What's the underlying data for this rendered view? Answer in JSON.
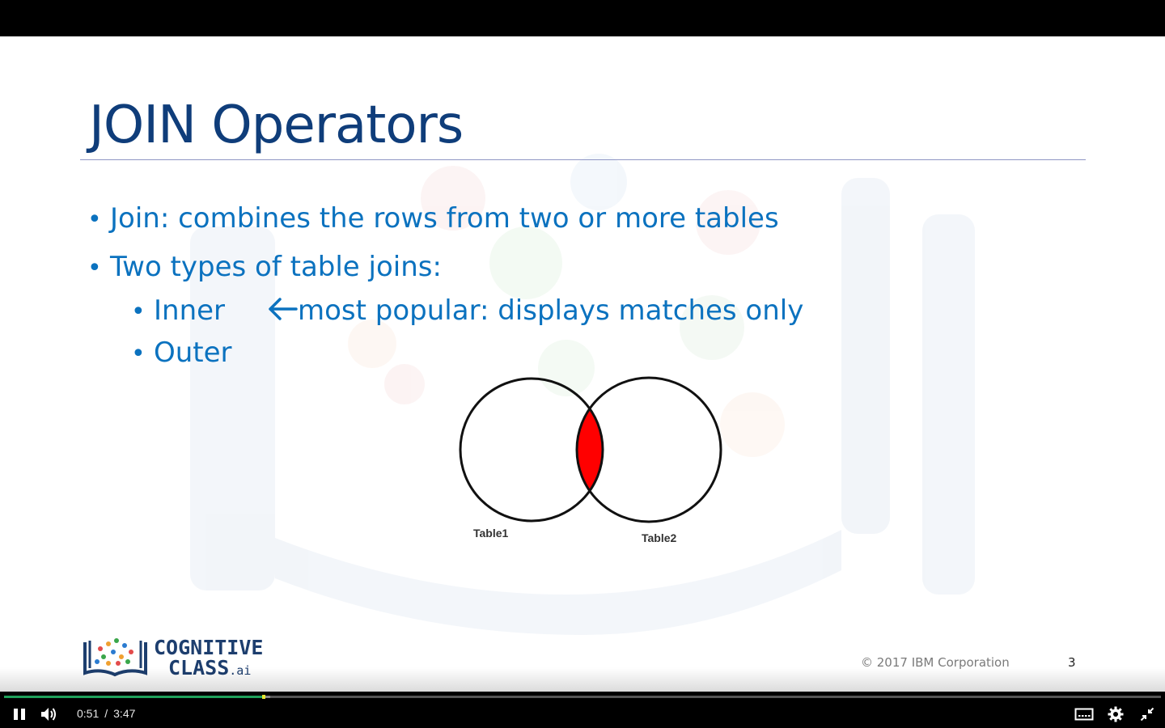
{
  "slide": {
    "title": "JOIN Operators",
    "bullets": [
      "Join: combines the rows from two or more tables",
      "Two types of table joins:"
    ],
    "sub_bullets": [
      "Inner",
      "Outer"
    ],
    "inner_note": "most popular: displays matches only",
    "bullet_glyph": "•",
    "arrow_glyph": "🡐",
    "venn": {
      "left_label": "Table1",
      "right_label": "Table2",
      "intersection_color": "#ff0000"
    },
    "logo": {
      "line1": "COGNITIVE",
      "line2": "CLASS",
      "suffix": ".ai"
    },
    "copyright": "© 2017 IBM Corporation",
    "page_number": "3"
  },
  "player": {
    "current_time": "0:51",
    "separator": "/",
    "duration": "3:47",
    "progress_fraction": 0.2247,
    "buffered_fraction": 0.23,
    "state": "playing",
    "icons": [
      "pause-icon",
      "volume-icon",
      "captions-icon",
      "settings-icon",
      "exit-fullscreen-icon"
    ],
    "colors": {
      "progress": "#1fa05a",
      "handle": "#e8e832"
    }
  }
}
